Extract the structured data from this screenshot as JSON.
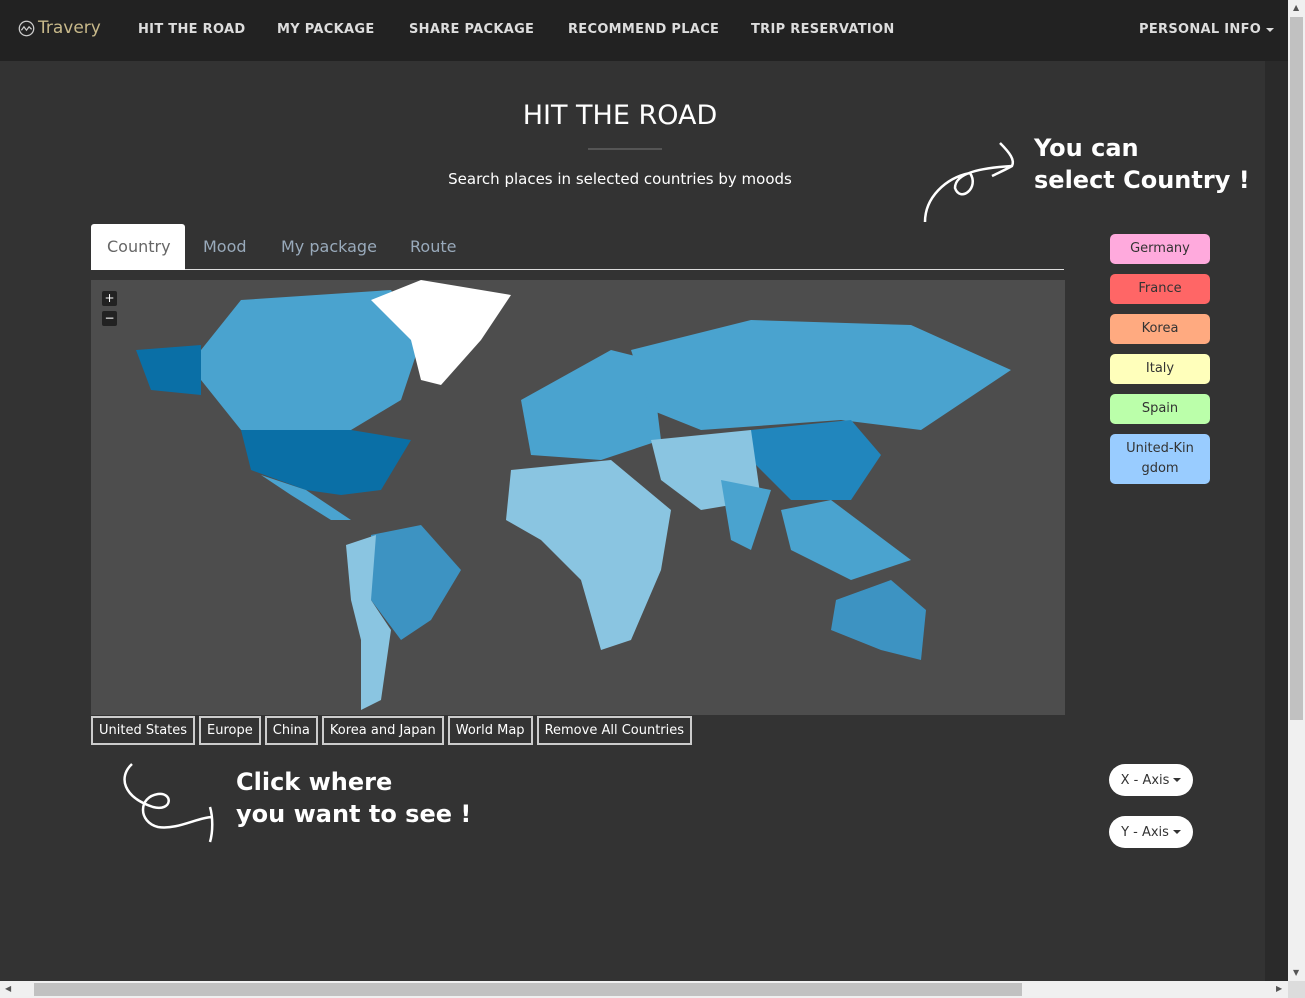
{
  "nav": {
    "brand": "Travery",
    "items": [
      "HIT THE ROAD",
      "MY PACKAGE",
      "SHARE PACKAGE",
      "RECOMMEND PLACE",
      "TRIP RESERVATION"
    ],
    "personal": "PERSONAL INFO"
  },
  "page": {
    "title": "HIT THE ROAD",
    "subtitle": "Search places in selected countries by moods",
    "note_top": [
      "You can",
      "select Country !"
    ],
    "note_bottom": [
      "Click where",
      "you want to see !"
    ]
  },
  "tabs": [
    {
      "label": "Country",
      "active": true
    },
    {
      "label": "Mood"
    },
    {
      "label": "My package"
    },
    {
      "label": "Route"
    }
  ],
  "map": {
    "zoom_in": "+",
    "zoom_out": "−"
  },
  "regions": [
    "United States",
    "Europe",
    "China",
    "Korea and Japan",
    "World Map",
    "Remove All Countries"
  ],
  "countries": [
    {
      "label": "Germany",
      "color": "#ffaadd"
    },
    {
      "label": "France",
      "color": "#ff6666"
    },
    {
      "label": "Korea",
      "color": "#ffaa80"
    },
    {
      "label": "Italy",
      "color": "#ffffbb"
    },
    {
      "label": "Spain",
      "color": "#bbffaa"
    },
    {
      "label": "United-Kingdom",
      "color": "#99ccff"
    }
  ],
  "axes": {
    "x": "X - Axis",
    "y": "Y - Axis"
  }
}
